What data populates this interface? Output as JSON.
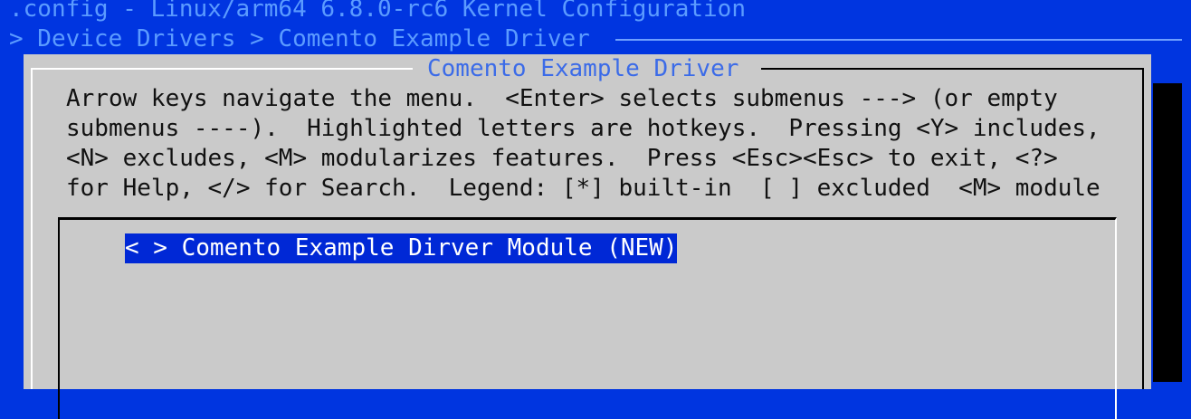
{
  "header": {
    "title": ".config - Linux/arm64 6.8.0-rc6 Kernel Configuration",
    "breadcrumb": "> Device Drivers > Comento Example Driver"
  },
  "dialog": {
    "title": "Comento Example Driver",
    "help_lines": [
      "Arrow keys navigate the menu.  <Enter> selects submenus ---> (or empty",
      "submenus ----).  Highlighted letters are hotkeys.  Pressing <Y> includes,",
      "<N> excludes, <M> modularizes features.  Press <Esc><Esc> to exit, <?>",
      "for Help, </> for Search.  Legend: [*] built-in  [ ] excluded  <M> module"
    ],
    "menu": {
      "items": [
        {
          "label": "< > Comento Example Dirver Module (NEW)",
          "selected": true
        }
      ]
    }
  },
  "colors": {
    "background": "#0035e0",
    "dialog": "#cacaca",
    "title_text": "#5b9bff",
    "highlight": "#0028d6"
  }
}
